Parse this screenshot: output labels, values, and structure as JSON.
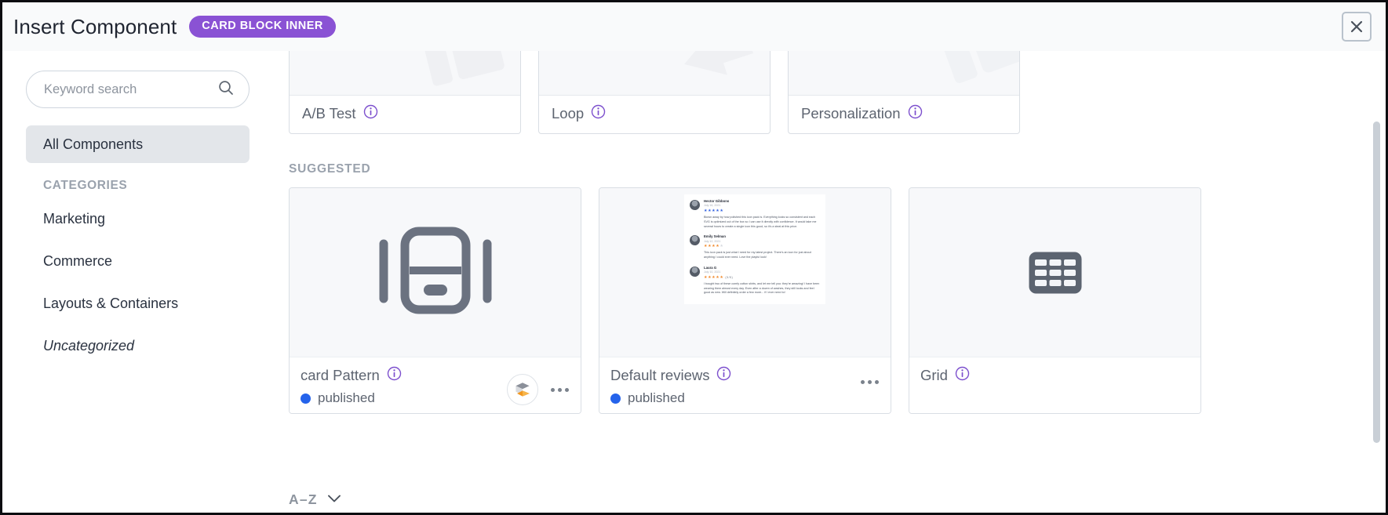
{
  "header": {
    "title": "Insert Component",
    "badge": "CARD BLOCK INNER",
    "close_icon": "close-icon"
  },
  "sidebar": {
    "search": {
      "placeholder": "Keyword search",
      "value": "",
      "icon": "search-icon"
    },
    "all_components": "All Components",
    "categories_label": "CATEGORIES",
    "items": [
      {
        "label": "Marketing",
        "italic": false
      },
      {
        "label": "Commerce",
        "italic": false
      },
      {
        "label": "Layouts & Containers",
        "italic": false
      },
      {
        "label": "Uncategorized",
        "italic": true
      }
    ]
  },
  "content": {
    "top_row": [
      {
        "title": "A/B Test",
        "info_icon": "info-icon"
      },
      {
        "title": "Loop",
        "info_icon": "info-icon"
      },
      {
        "title": "Personalization",
        "info_icon": "info-icon"
      }
    ],
    "suggested_label": "SUGGESTED",
    "suggested": [
      {
        "title": "card Pattern",
        "info_icon": "info-icon",
        "status": "published",
        "status_color": "#2563eb",
        "thumb_icon": "card-pattern-icon",
        "has_badge": true,
        "badge_icon": "adobe-cube-icon",
        "has_menu": true,
        "menu_icon": "more-options-icon"
      },
      {
        "title": "Default reviews",
        "info_icon": "info-icon",
        "status": "published",
        "status_color": "#2563eb",
        "thumb_icon": "reviews-preview",
        "has_badge": false,
        "has_menu": true,
        "menu_icon": "more-options-icon",
        "reviews": [
          {
            "name": "Hector Gibbons",
            "date": "July 16, 2021",
            "stars": 5,
            "star_color": "blue",
            "ratio": "",
            "text": "Blown away by how polished this icon pack is. Everything looks so consistent and each SVG is optimized out of the box so I can use it directly with confidence. It would take me several hours to create a single icon this good, so it's a steal at this price."
          },
          {
            "name": "Emily Selman",
            "date": "July 12, 2021",
            "stars": 4,
            "star_color": "orange",
            "ratio": "",
            "text": "This icon pack is just what I need for my latest project. There's an icon for just about anything I could ever need. Love the playful look!"
          },
          {
            "name": "Laura G",
            "date": "July 10, 2021",
            "stars": 5,
            "star_color": "orange",
            "ratio": "(5/5)",
            "text": "I bought two of these comfy cotton shirts, and let me tell you: they're amazing! I have been wearing them almost every day. Even after a dozen of washes, they still looks and feel good as new. Will definitely order a few more... if I ever need to!"
          }
        ]
      },
      {
        "title": "Grid",
        "info_icon": "info-icon",
        "status": "",
        "thumb_icon": "grid-table-icon",
        "has_badge": false,
        "has_menu": false
      }
    ],
    "sort": {
      "label": "A–Z",
      "icon": "chevron-down-icon"
    }
  },
  "colors": {
    "accent_purple": "#8a52d4",
    "info_purple": "#7c4fcd",
    "status_blue": "#2563eb",
    "text_dark": "#1f2430",
    "text_muted": "#5d6470",
    "label_gray": "#9aa2ad"
  }
}
